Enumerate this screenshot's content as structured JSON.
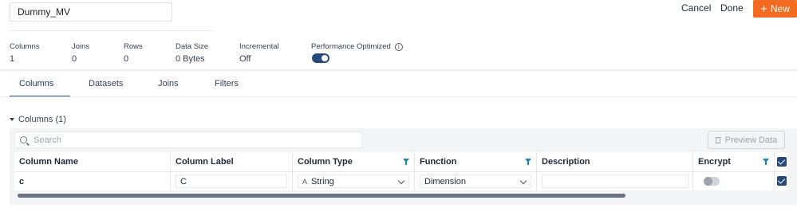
{
  "view": {
    "name": "Dummy_MV"
  },
  "actions": {
    "cancel": "Cancel",
    "done": "Done",
    "new": "New",
    "new_icon": "plus-icon"
  },
  "stats": [
    {
      "label": "Columns",
      "value": "1"
    },
    {
      "label": "Joins",
      "value": "0"
    },
    {
      "label": "Rows",
      "value": "0"
    },
    {
      "label": "Data Size",
      "value": "0 Bytes"
    },
    {
      "label": "Incremental",
      "value": "Off"
    }
  ],
  "performance": {
    "label": "Performance Optimized",
    "enabled": true
  },
  "tabs": [
    {
      "label": "Columns",
      "active": true
    },
    {
      "label": "Datasets",
      "active": false
    },
    {
      "label": "Joins",
      "active": false
    },
    {
      "label": "Filters",
      "active": false
    }
  ],
  "section": {
    "title": "Columns (1)"
  },
  "search": {
    "placeholder": "Search",
    "value": ""
  },
  "preview_button": "Preview Data",
  "table": {
    "headers": [
      "Column Name",
      "Column Label",
      "Column Type",
      "Function",
      "Description",
      "Encrypt"
    ],
    "rows": [
      {
        "name": "c",
        "label": "C",
        "type": "String",
        "type_icon": "A",
        "function": "Dimension",
        "description": "",
        "encrypt": false,
        "selected": true
      }
    ]
  },
  "colors": {
    "accent": "#f26b21",
    "primary": "#27497a",
    "filter": "#1b84b1"
  }
}
